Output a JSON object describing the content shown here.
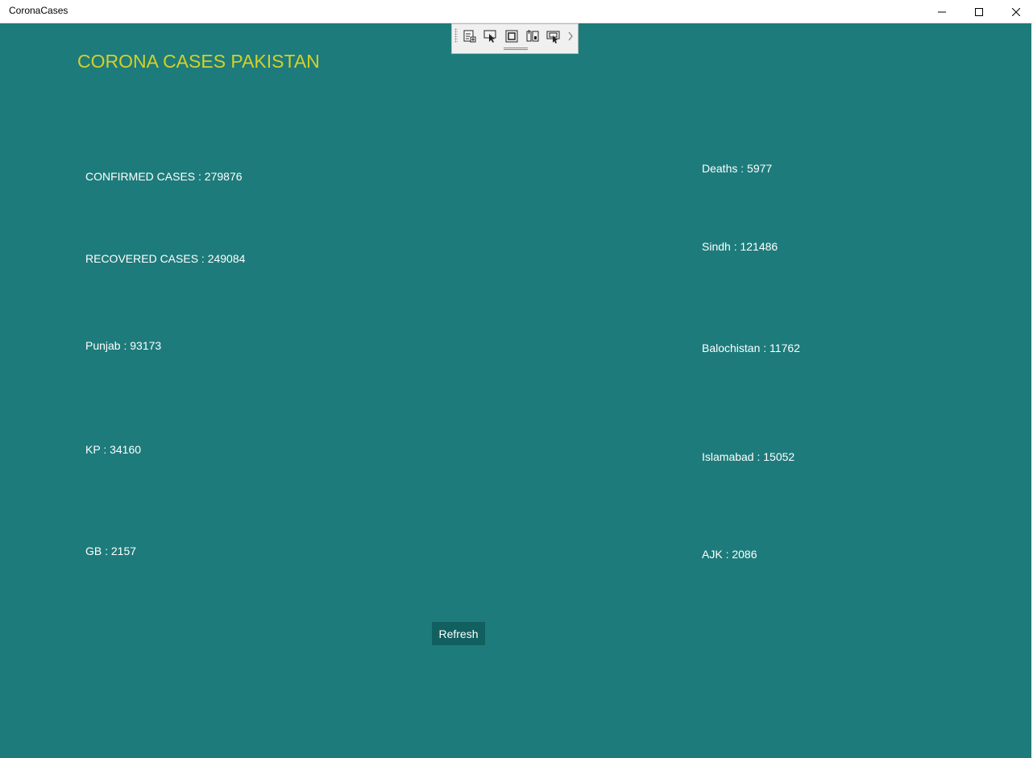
{
  "window": {
    "title": "CoronaCases",
    "minimize_icon": "minimize-icon",
    "maximize_icon": "maximize-icon",
    "close_icon": "close-icon"
  },
  "debug_toolbar": {
    "icons": [
      "live-visual-tree-icon",
      "select-element-icon",
      "display-layout-adorners-icon",
      "track-focus-icon",
      "hot-reload-icon",
      "chevron-right-icon"
    ]
  },
  "app": {
    "heading": "CORONA CASES PAKISTAN",
    "heading_color": "#d4d02a",
    "background_color": "#1e7b7b",
    "refresh_label": "Refresh"
  },
  "left_stats": {
    "confirmed": "CONFIRMED CASES : 279876",
    "recovered": "RECOVERED CASES : 249084",
    "punjab": "Punjab : 93173",
    "kp": "KP : 34160",
    "gb": "GB : 2157"
  },
  "right_stats": {
    "deaths": "Deaths : 5977",
    "sindh": "Sindh : 121486",
    "balochistan": "Balochistan : 11762",
    "islamabad": "Islamabad : 15052",
    "ajk": "AJK : 2086"
  }
}
